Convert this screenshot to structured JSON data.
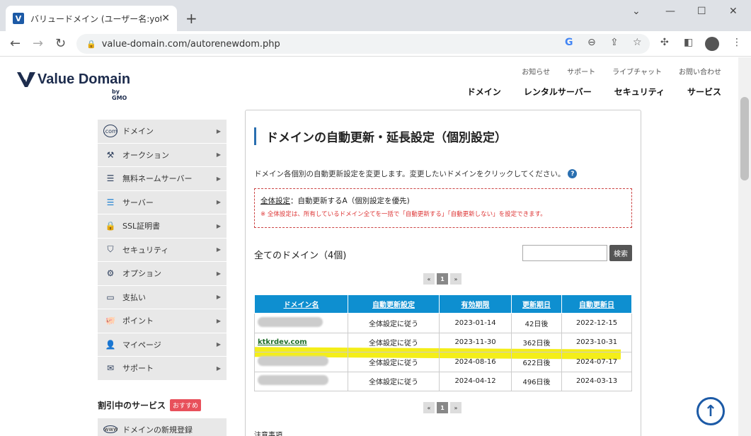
{
  "browser": {
    "tab_title": "バリュードメイン (ユーザー名:yotan)",
    "url": "value-domain.com/autorenewdom.php"
  },
  "header": {
    "logo_text": "Value Domain",
    "logo_sub": "by GMO",
    "top_links": [
      "お知らせ",
      "サポート",
      "ライブチャット",
      "お問い合わせ"
    ],
    "main_nav": [
      "ドメイン",
      "レンタルサーバー",
      "セキュリティ",
      "サービス"
    ]
  },
  "sidebar": {
    "items": [
      {
        "label": "ドメイン",
        "icon": "dotcom-icon"
      },
      {
        "label": "オークション",
        "icon": "gavel-icon"
      },
      {
        "label": "無料ネームサーバー",
        "icon": "server-stack-icon"
      },
      {
        "label": "サーバー",
        "icon": "server-icon"
      },
      {
        "label": "SSL証明書",
        "icon": "ssl-lock-icon"
      },
      {
        "label": "セキュリティ",
        "icon": "shield-icon"
      },
      {
        "label": "オプション",
        "icon": "gears-icon"
      },
      {
        "label": "支払い",
        "icon": "wallet-icon"
      },
      {
        "label": "ポイント",
        "icon": "piggy-bank-icon"
      },
      {
        "label": "マイページ",
        "icon": "user-icon"
      },
      {
        "label": "サポート",
        "icon": "mail-icon"
      }
    ],
    "promo_title": "割引中のサービス",
    "promo_badge": "おすすめ",
    "promo_item": "ドメインの新規登録"
  },
  "main": {
    "title": "ドメインの自動更新・延長設定（個別設定）",
    "description": "ドメイン各個別の自動更新設定を変更します。変更したいドメインをクリックしてください。",
    "help": "?",
    "global_setting_label": "全体設定",
    "global_setting_value": "：自動更新するA（個別設定を優先)",
    "global_setting_note": "※ 全体設定は、所有しているドメイン全てを一括で「自動更新する」「自動更新しない」を設定できます。",
    "domain_count": "全てのドメイン（4個)",
    "search_button": "検索",
    "pager": {
      "prev": "«",
      "current": "1",
      "next": "»"
    },
    "table": {
      "headers": [
        "ドメイン名",
        "自動更新設定",
        "有効期限",
        "更新期日",
        "自動更新日"
      ],
      "rows": [
        {
          "domain": "",
          "setting": "全体設定に従う",
          "expiry": "2023-01-14",
          "due": "42日後",
          "auto_date": "2022-12-15"
        },
        {
          "domain": "ktkrdev.com",
          "setting": "全体設定に従う",
          "expiry": "2023-11-30",
          "due": "362日後",
          "auto_date": "2023-10-31"
        },
        {
          "domain": "",
          "setting": "全体設定に従う",
          "expiry": "2024-08-16",
          "due": "622日後",
          "auto_date": "2024-07-17"
        },
        {
          "domain": "",
          "setting": "全体設定に従う",
          "expiry": "2024-04-12",
          "due": "496日後",
          "auto_date": "2024-03-13"
        }
      ]
    },
    "caution": "注意事項"
  }
}
